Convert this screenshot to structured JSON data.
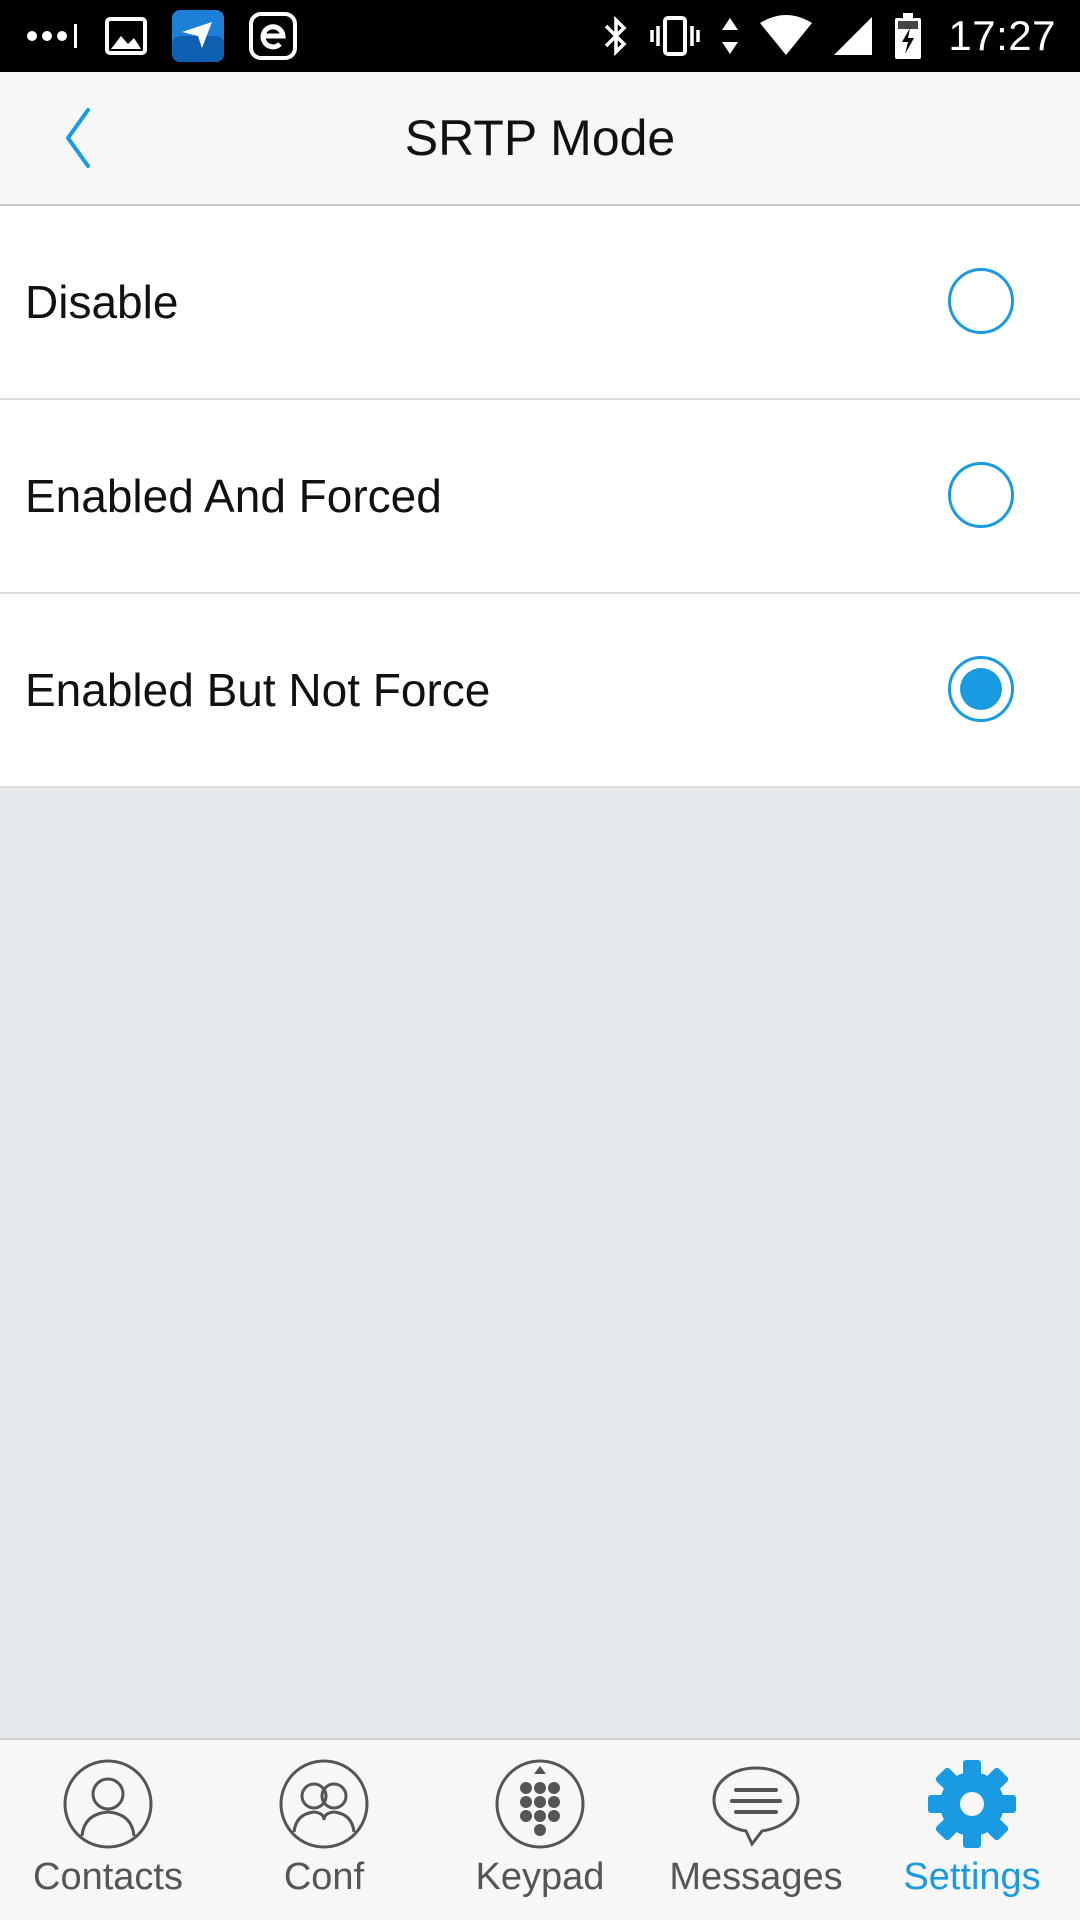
{
  "status_bar": {
    "time": "17:27",
    "left_icons": [
      "more-dots-icon",
      "gallery-icon",
      "grandstream-app-icon",
      "e-app-icon"
    ],
    "right_icons": [
      "bluetooth-icon",
      "vibrate-icon",
      "data-arrows-icon",
      "wifi-icon",
      "cell-signal-icon",
      "battery-charging-icon"
    ]
  },
  "header": {
    "title": "SRTP Mode",
    "back_icon": "chevron-left-icon"
  },
  "options": [
    {
      "label": "Disable",
      "selected": false
    },
    {
      "label": "Enabled And Forced",
      "selected": false
    },
    {
      "label": "Enabled But Not Force",
      "selected": true
    }
  ],
  "bottom_nav": {
    "items": [
      {
        "label": "Contacts",
        "icon": "contact-icon",
        "active": false
      },
      {
        "label": "Conf",
        "icon": "conference-icon",
        "active": false
      },
      {
        "label": "Keypad",
        "icon": "keypad-icon",
        "active": false
      },
      {
        "label": "Messages",
        "icon": "message-bubble-icon",
        "active": false
      },
      {
        "label": "Settings",
        "icon": "gear-icon",
        "active": true
      }
    ]
  },
  "colors": {
    "accent": "#1a9ae0",
    "inactive": "#555555",
    "background": "#e6e9ec"
  }
}
